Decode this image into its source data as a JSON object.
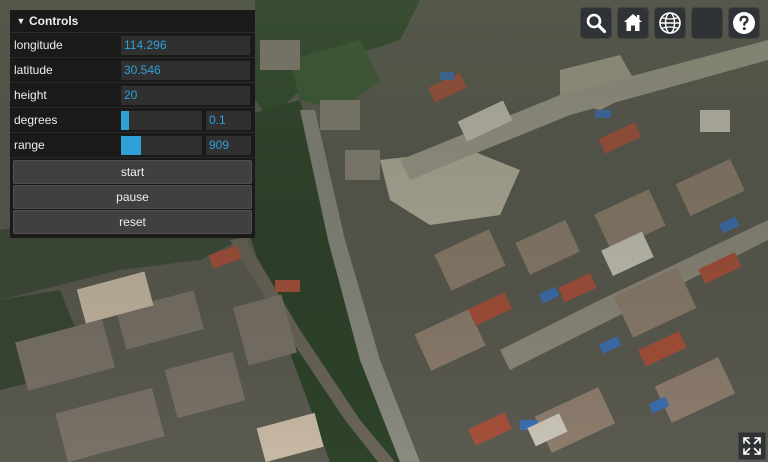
{
  "panel": {
    "title": "Controls",
    "fields": {
      "longitude": {
        "label": "longitude",
        "value": "114.296"
      },
      "latitude": {
        "label": "latitude",
        "value": "30.546"
      },
      "height": {
        "label": "height",
        "value": "20"
      }
    },
    "sliders": {
      "degrees": {
        "label": "degrees",
        "value": "0.1",
        "fill_fraction": 0.1
      },
      "range": {
        "label": "range",
        "value": "909",
        "fill_fraction": 0.25
      }
    },
    "buttons": {
      "start": "start",
      "pause": "pause",
      "reset": "reset"
    }
  },
  "toolbar": {
    "icons": [
      "search-icon",
      "home-icon",
      "globe-icon",
      "blank-button",
      "help-icon"
    ]
  },
  "fullscreen": {
    "icon": "fullscreen-icon"
  },
  "colors": {
    "panel_bg": "#1a1a1a",
    "input_bg": "#303030",
    "accent": "#2fa1d6",
    "button_bg": "#303336"
  }
}
